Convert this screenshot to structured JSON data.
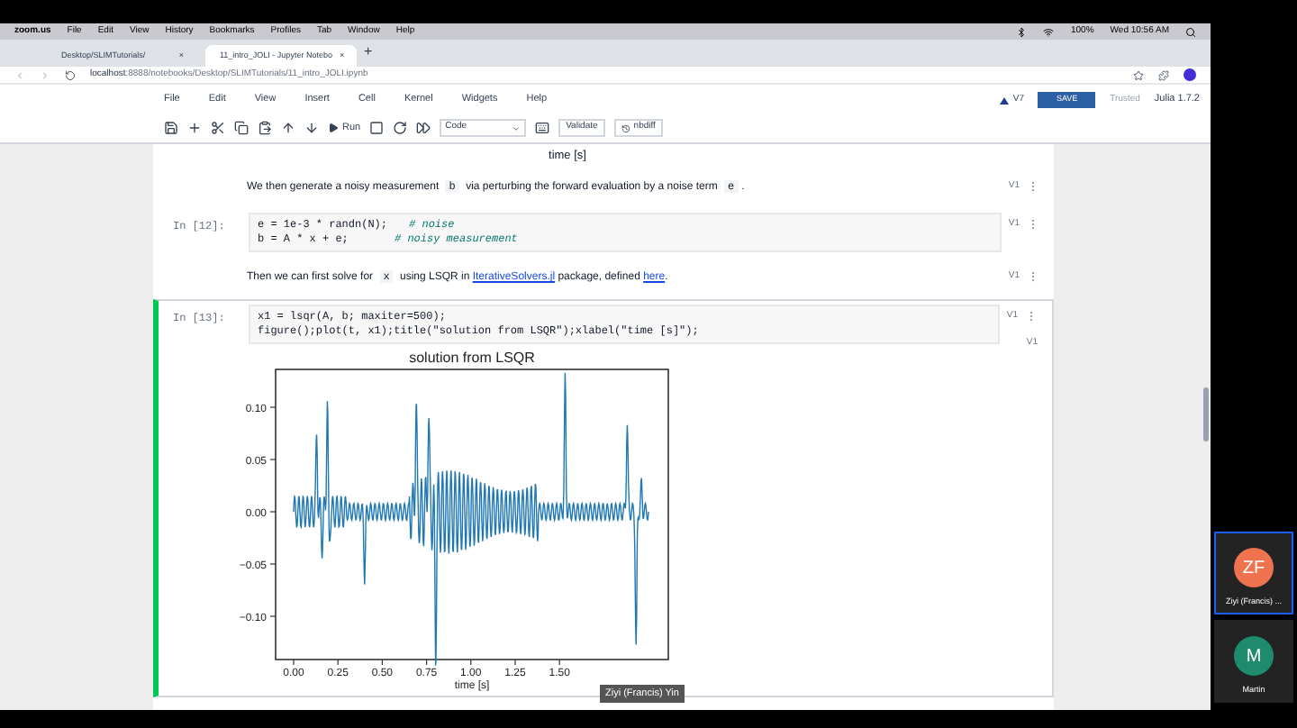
{
  "menubar": {
    "app": "zoom.us",
    "items": [
      "File",
      "Edit",
      "View",
      "History",
      "Bookmarks",
      "Profiles",
      "Tab",
      "Window",
      "Help"
    ],
    "battery": "100%",
    "clock": "Wed 10:56 AM"
  },
  "browser": {
    "tabs": [
      {
        "title": "Desktop/SLIMTutorials/",
        "close": "×",
        "selected": false
      },
      {
        "title": "11_intro_JOLI - Jupyter Notebo",
        "close": "×",
        "selected": true
      }
    ],
    "new_tab": "+",
    "url_host": "localhost",
    "url_path": ":8888/notebooks/Desktop/SLIMTutorials/11_intro_JOLI.ipynb"
  },
  "jupyter": {
    "menu": [
      "File",
      "Edit",
      "View",
      "Insert",
      "Cell",
      "Kernel",
      "Widgets",
      "Help"
    ],
    "run": "Run",
    "cell_type": "Code",
    "validate": "Validate",
    "nbdiff": "nbdiff",
    "version": "V7",
    "save": "SAVE",
    "trusted": "Trusted",
    "kernel": "Julia 1.7.2"
  },
  "cells": [
    {
      "kind": "output_text",
      "text": "time [s]"
    },
    {
      "kind": "markdown",
      "version": "V1",
      "segments": [
        {
          "kind": "text",
          "text": "We then generate a noisy measurement"
        },
        {
          "kind": "code",
          "text": "b"
        },
        {
          "kind": "text",
          "text": "via perturbing the forward evaluation by a noise term"
        },
        {
          "kind": "code",
          "text": "e"
        },
        {
          "kind": "text",
          "text": "."
        }
      ]
    },
    {
      "kind": "code",
      "prompt": "In [12]:",
      "version": "V1",
      "selected": false,
      "lines": [
        {
          "code": "e = 1e-3 * randn(N);",
          "comment": "# noise"
        },
        {
          "code": "b = A * x + e;",
          "comment": "# noisy measurement"
        }
      ]
    },
    {
      "kind": "markdown",
      "version": "V1",
      "segments": [
        {
          "kind": "text",
          "text": "Then we can first solve for"
        },
        {
          "kind": "code",
          "text": "x"
        },
        {
          "kind": "text",
          "text": "using LSQR in"
        },
        {
          "kind": "link",
          "text": "IterativeSolvers.jl"
        },
        {
          "kind": "text",
          "text": "package, defined"
        },
        {
          "kind": "link",
          "text": "here"
        },
        {
          "kind": "text",
          "text": "."
        }
      ]
    },
    {
      "kind": "code",
      "prompt": "In [13]:",
      "version": "V1",
      "selected": true,
      "lines": [
        {
          "code": "x1 = lsqr(A, b; maxiter=500);"
        },
        {
          "code": "figure();plot(t, x1);title(\"solution from LSQR\");xlabel(\"time [s]\");"
        }
      ],
      "output": {
        "version": "V1",
        "title": "solution from LSQR",
        "xlabel": "time [s]",
        "yticks": [
          "0.10",
          "0.05",
          "0.00",
          "−0.05",
          "−0.10"
        ],
        "xticks": [
          "0.00",
          "0.25",
          "0.50",
          "0.75",
          "1.00",
          "1.25",
          "1.50"
        ]
      }
    }
  ],
  "zoom": {
    "speaker_label": "Ziyi (Francis) Yin",
    "participants": [
      {
        "initials": "ZF",
        "name": "Ziyi (Francis) ...",
        "color": "#f0734f",
        "selected": true
      },
      {
        "initials": "M",
        "name": "Martin",
        "color": "#1f8a6c",
        "selected": false
      }
    ]
  }
}
